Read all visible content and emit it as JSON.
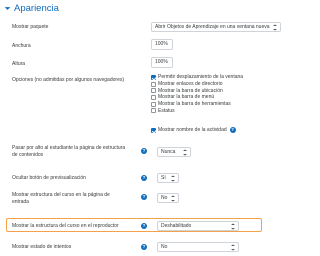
{
  "section": {
    "title": "Apariencia"
  },
  "fields": {
    "mostrar_paquete": {
      "label": "Mostrar paquete",
      "value": "Abrir Objetos de Aprendizaje en una ventana nueva"
    },
    "anchura": {
      "label": "Anchura",
      "value": "100%"
    },
    "altura": {
      "label": "Altura",
      "value": "100%"
    },
    "opciones": {
      "label": "Opciones (no admitidas por algunos navegadores)",
      "items": [
        {
          "label": "Permitir desplazamiento de la ventana",
          "checked": true
        },
        {
          "label": "Mostrar enlaces de directorio",
          "checked": false
        },
        {
          "label": "Mostrar la barra de ubicación",
          "checked": false
        },
        {
          "label": "Mostrar la barra de menú",
          "checked": false
        },
        {
          "label": "Mostrar la barra de herramientas",
          "checked": false
        },
        {
          "label": "Estatus",
          "checked": false
        }
      ],
      "activity_name": {
        "label": "Mostrar nombre de la actividad",
        "checked": true
      }
    },
    "pasar_por_alto": {
      "label_line1": "Pasar por alto al estudiante la página de estructura",
      "label_line2": "de contenidos",
      "value": "Nunca"
    },
    "ocultar_boton": {
      "label": "Ocultar botón de previsualización",
      "value": "Sí"
    },
    "mostrar_estructura": {
      "label_line1": "Mostrar estructura del curso en la página de",
      "label_line2": "entrada",
      "value": "No"
    },
    "estructura_reproductor": {
      "label": "Mostrar la estructura del curso en el reproductor",
      "value": "Deshabilitado"
    },
    "estado_intentos": {
      "label": "Mostrar estado de intentos",
      "value": "No"
    }
  },
  "help_icon": "question-circle-icon",
  "colors": {
    "accent": "#0f6cbf",
    "highlight": "#f4a24a",
    "border": "#ced4da"
  }
}
